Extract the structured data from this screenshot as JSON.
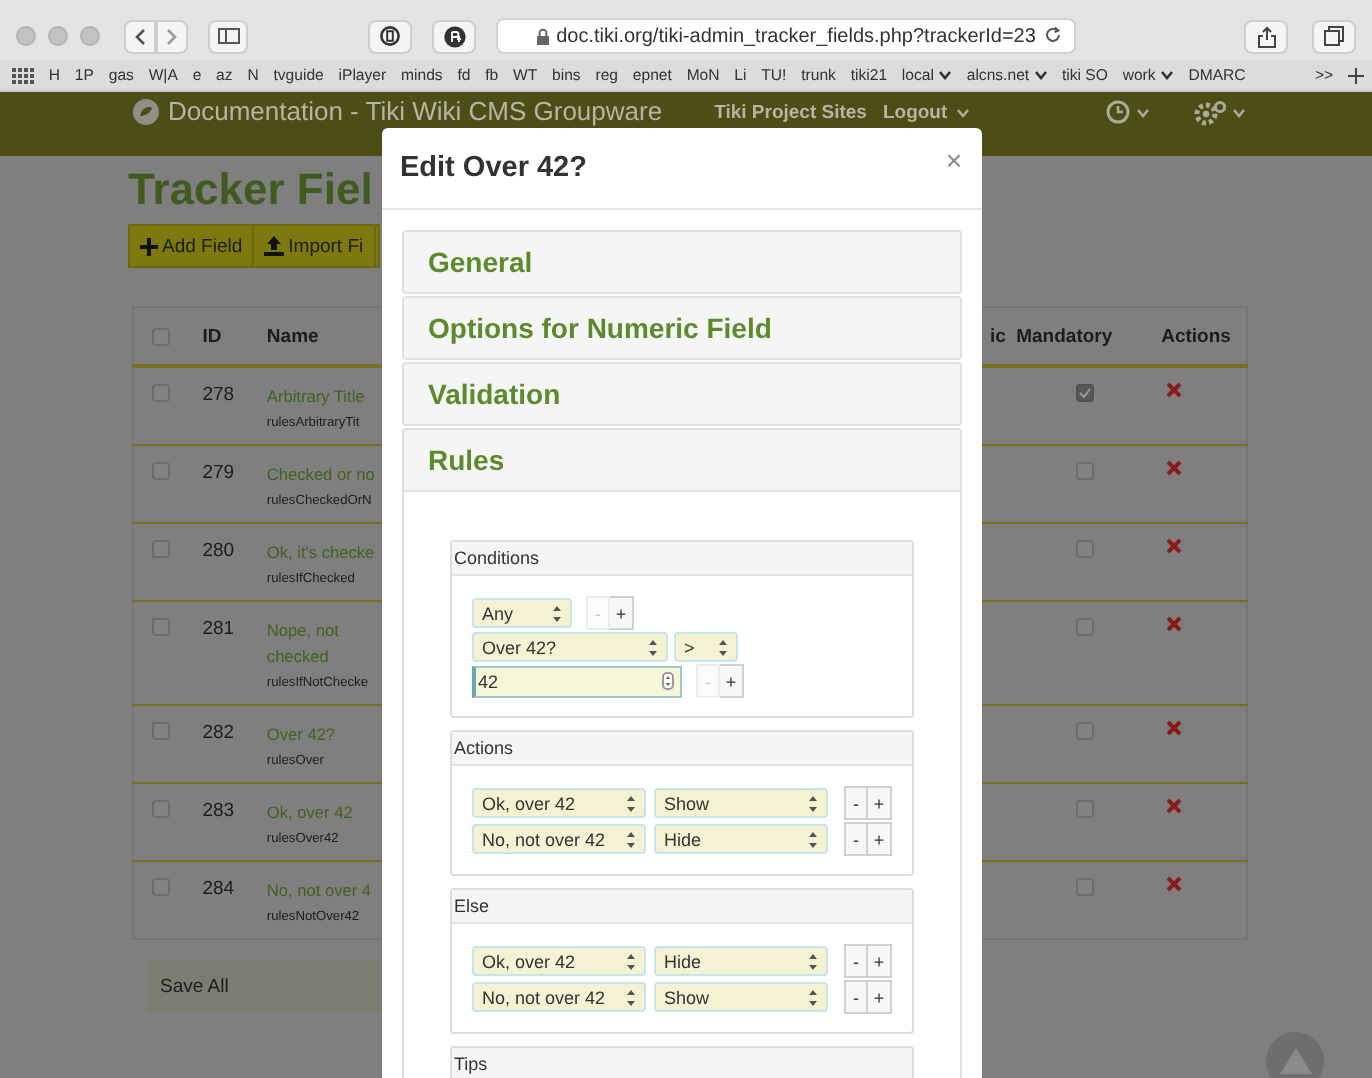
{
  "browser": {
    "address": "doc.tiki.org/tiki-admin_tracker_fields.php?trackerId=23",
    "bookmarks": [
      {
        "label": "H",
        "menu": false
      },
      {
        "label": "1P",
        "menu": false
      },
      {
        "label": "gas",
        "menu": false
      },
      {
        "label": "W|A",
        "menu": false
      },
      {
        "label": "e",
        "menu": false
      },
      {
        "label": "az",
        "menu": false
      },
      {
        "label": "N",
        "menu": false
      },
      {
        "label": "tvguide",
        "menu": false
      },
      {
        "label": "iPlayer",
        "menu": false
      },
      {
        "label": "minds",
        "menu": false
      },
      {
        "label": "fd",
        "menu": false
      },
      {
        "label": "fb",
        "menu": false
      },
      {
        "label": "WT",
        "menu": false
      },
      {
        "label": "bins",
        "menu": false
      },
      {
        "label": "reg",
        "menu": false
      },
      {
        "label": "epnet",
        "menu": false
      },
      {
        "label": "MoN",
        "menu": false
      },
      {
        "label": "Li",
        "menu": false
      },
      {
        "label": "TU!",
        "menu": false
      },
      {
        "label": "trunk",
        "menu": false
      },
      {
        "label": "tiki21",
        "menu": false
      },
      {
        "label": "local",
        "menu": true
      },
      {
        "label": "alcns.net",
        "menu": true
      },
      {
        "label": "tiki SO",
        "menu": false
      },
      {
        "label": "work",
        "menu": true
      },
      {
        "label": "DMARC",
        "menu": false
      }
    ],
    "overflow": ">>"
  },
  "site_header": {
    "title": "Documentation - Tiki Wiki CMS Groupware",
    "links": [
      {
        "label": "Tiki Project Sites",
        "menu": false
      },
      {
        "label": "Logout",
        "menu": true
      }
    ]
  },
  "page": {
    "title": "Tracker Fiel",
    "toolbar": [
      {
        "label": "Add Field"
      },
      {
        "label": "Import Fi"
      }
    ],
    "table": {
      "columns": [
        "ID",
        "Name",
        "ic",
        "Mandatory",
        "Actions"
      ],
      "select_all": false,
      "rows": [
        {
          "checked": false,
          "id": "278",
          "name": "Arbitrary Title",
          "perm_name": "rulesArbitraryTit",
          "mandatory": true
        },
        {
          "checked": false,
          "id": "279",
          "name": "Checked or no",
          "perm_name": "rulesCheckedOrN",
          "mandatory": false
        },
        {
          "checked": false,
          "id": "280",
          "name": "Ok, it's checke",
          "perm_name": "rulesIfChecked",
          "mandatory": false
        },
        {
          "checked": false,
          "id": "281",
          "name": "Nope, not checked",
          "perm_name": "rulesIfNotChecke",
          "mandatory": false
        },
        {
          "checked": false,
          "id": "282",
          "name": "Over 42?",
          "perm_name": "rulesOver",
          "mandatory": false
        },
        {
          "checked": false,
          "id": "283",
          "name": "Ok, over 42",
          "perm_name": "rulesOver42",
          "mandatory": false
        },
        {
          "checked": false,
          "id": "284",
          "name": "No, not over 4",
          "perm_name": "rulesNotOver42",
          "mandatory": false
        }
      ]
    },
    "save_button": "Save All"
  },
  "modal": {
    "title": "Edit Over 42?",
    "close": "×",
    "panels": [
      {
        "title": "General",
        "expanded": false
      },
      {
        "title": "Options for Numeric Field",
        "expanded": false
      },
      {
        "title": "Validation",
        "expanded": false
      },
      {
        "title": "Rules",
        "expanded": true
      }
    ],
    "rules": [
      {
        "kind": "conditions",
        "title": "Conditions",
        "rows": [
          [
            {
              "kind": "select",
              "value": "Any"
            },
            {
              "kind": "button",
              "label": "-",
              "disabled": true
            },
            {
              "kind": "button",
              "label": "+",
              "disabled": false
            }
          ],
          [
            {
              "kind": "select",
              "value": "Over 42?"
            },
            {
              "kind": "select",
              "value": ">"
            }
          ],
          [
            {
              "kind": "number",
              "value": "42"
            },
            {
              "kind": "button",
              "label": "-",
              "disabled": true
            },
            {
              "kind": "button",
              "label": "+",
              "disabled": false
            }
          ]
        ]
      },
      {
        "kind": "actions",
        "title": "Actions",
        "rows": [
          [
            {
              "kind": "select",
              "value": "Ok, over 42"
            },
            {
              "kind": "select",
              "value": "Show"
            },
            {
              "kind": "button",
              "label": "-",
              "disabled": false
            },
            {
              "kind": "button",
              "label": "+",
              "disabled": false
            }
          ],
          [
            {
              "kind": "select",
              "value": "No, not over 42"
            },
            {
              "kind": "select",
              "value": "Hide"
            },
            {
              "kind": "button",
              "label": "-",
              "disabled": false
            },
            {
              "kind": "button",
              "label": "+",
              "disabled": false
            }
          ]
        ]
      },
      {
        "kind": "actions",
        "title": "Else",
        "rows": [
          [
            {
              "kind": "select",
              "value": "Ok, over 42"
            },
            {
              "kind": "select",
              "value": "Hide"
            },
            {
              "kind": "button",
              "label": "-",
              "disabled": false
            },
            {
              "kind": "button",
              "label": "+",
              "disabled": false
            }
          ],
          [
            {
              "kind": "select",
              "value": "No, not over 42"
            },
            {
              "kind": "select",
              "value": "Show"
            },
            {
              "kind": "button",
              "label": "-",
              "disabled": false
            },
            {
              "kind": "button",
              "label": "+",
              "disabled": false
            }
          ]
        ]
      },
      {
        "kind": "notes",
        "title": "Tips"
      }
    ]
  }
}
